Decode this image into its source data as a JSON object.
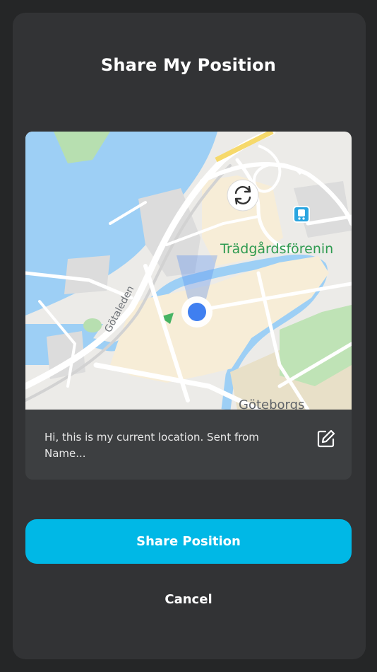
{
  "dialog": {
    "title": "Share My Position"
  },
  "map": {
    "labels": {
      "park": "Trädgårdsförenin",
      "district": "Göteborgs",
      "road": "Götaleden"
    },
    "icons": {
      "recenter": "refresh-icon",
      "transit": "train-station-icon",
      "location": "location-dot-icon"
    }
  },
  "message": {
    "text": "Hi, this is my current location. Sent from Name...",
    "edit_icon": "edit-icon"
  },
  "actions": {
    "share_label": "Share Position",
    "cancel_label": "Cancel"
  },
  "colors": {
    "background": "#252627",
    "sheet": "#323335",
    "card": "#3d3f41",
    "accent": "#00b8e6",
    "location_dot": "#3f7ff0"
  }
}
